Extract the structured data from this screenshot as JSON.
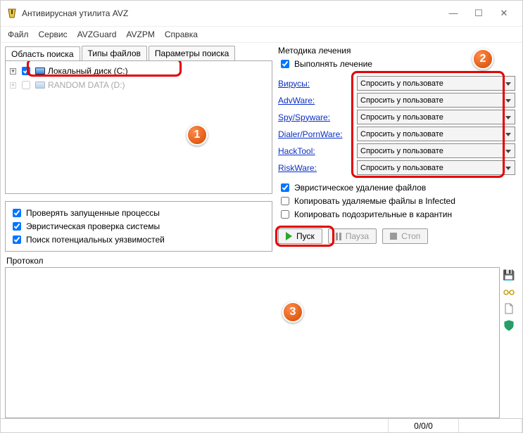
{
  "window": {
    "title": "Антивирусная утилита AVZ"
  },
  "menu": {
    "file": "Файл",
    "service": "Сервис",
    "avzguard": "AVZGuard",
    "avzpm": "AVZPM",
    "help": "Справка"
  },
  "tabs": {
    "scope": "Область поиска",
    "filetypes": "Типы файлов",
    "params": "Параметры поиска"
  },
  "tree": {
    "item1": "Локальный диск (C:)",
    "item2": "RANDOM DATA (D:)"
  },
  "checks": {
    "processes": "Проверять запущенные процессы",
    "heuristic_system": "Эвристическая проверка системы",
    "vuln": "Поиск потенциальных уязвимостей"
  },
  "cure": {
    "section": "Методика лечения",
    "perform": "Выполнять лечение",
    "rows": {
      "viruses": "Вирусы:",
      "advware": "AdvWare:",
      "spy": "Spy/Spyware:",
      "dialer": "Dialer/PornWare:",
      "hacktool": "HackTool:",
      "riskware": "RiskWare:"
    },
    "option": "Спросить у пользовате",
    "extra": {
      "heur_delete": "Эвристическое удаление файлов",
      "copy_infected": "Копировать удаляемые файлы в Infected",
      "copy_quarantine": "Копировать подозрительные в карантин"
    }
  },
  "buttons": {
    "start": "Пуск",
    "pause": "Пауза",
    "stop": "Стоп"
  },
  "protocol": {
    "label": "Протокол"
  },
  "status": {
    "counts": "0/0/0"
  },
  "badges": {
    "b1": "1",
    "b2": "2",
    "b3": "3"
  }
}
